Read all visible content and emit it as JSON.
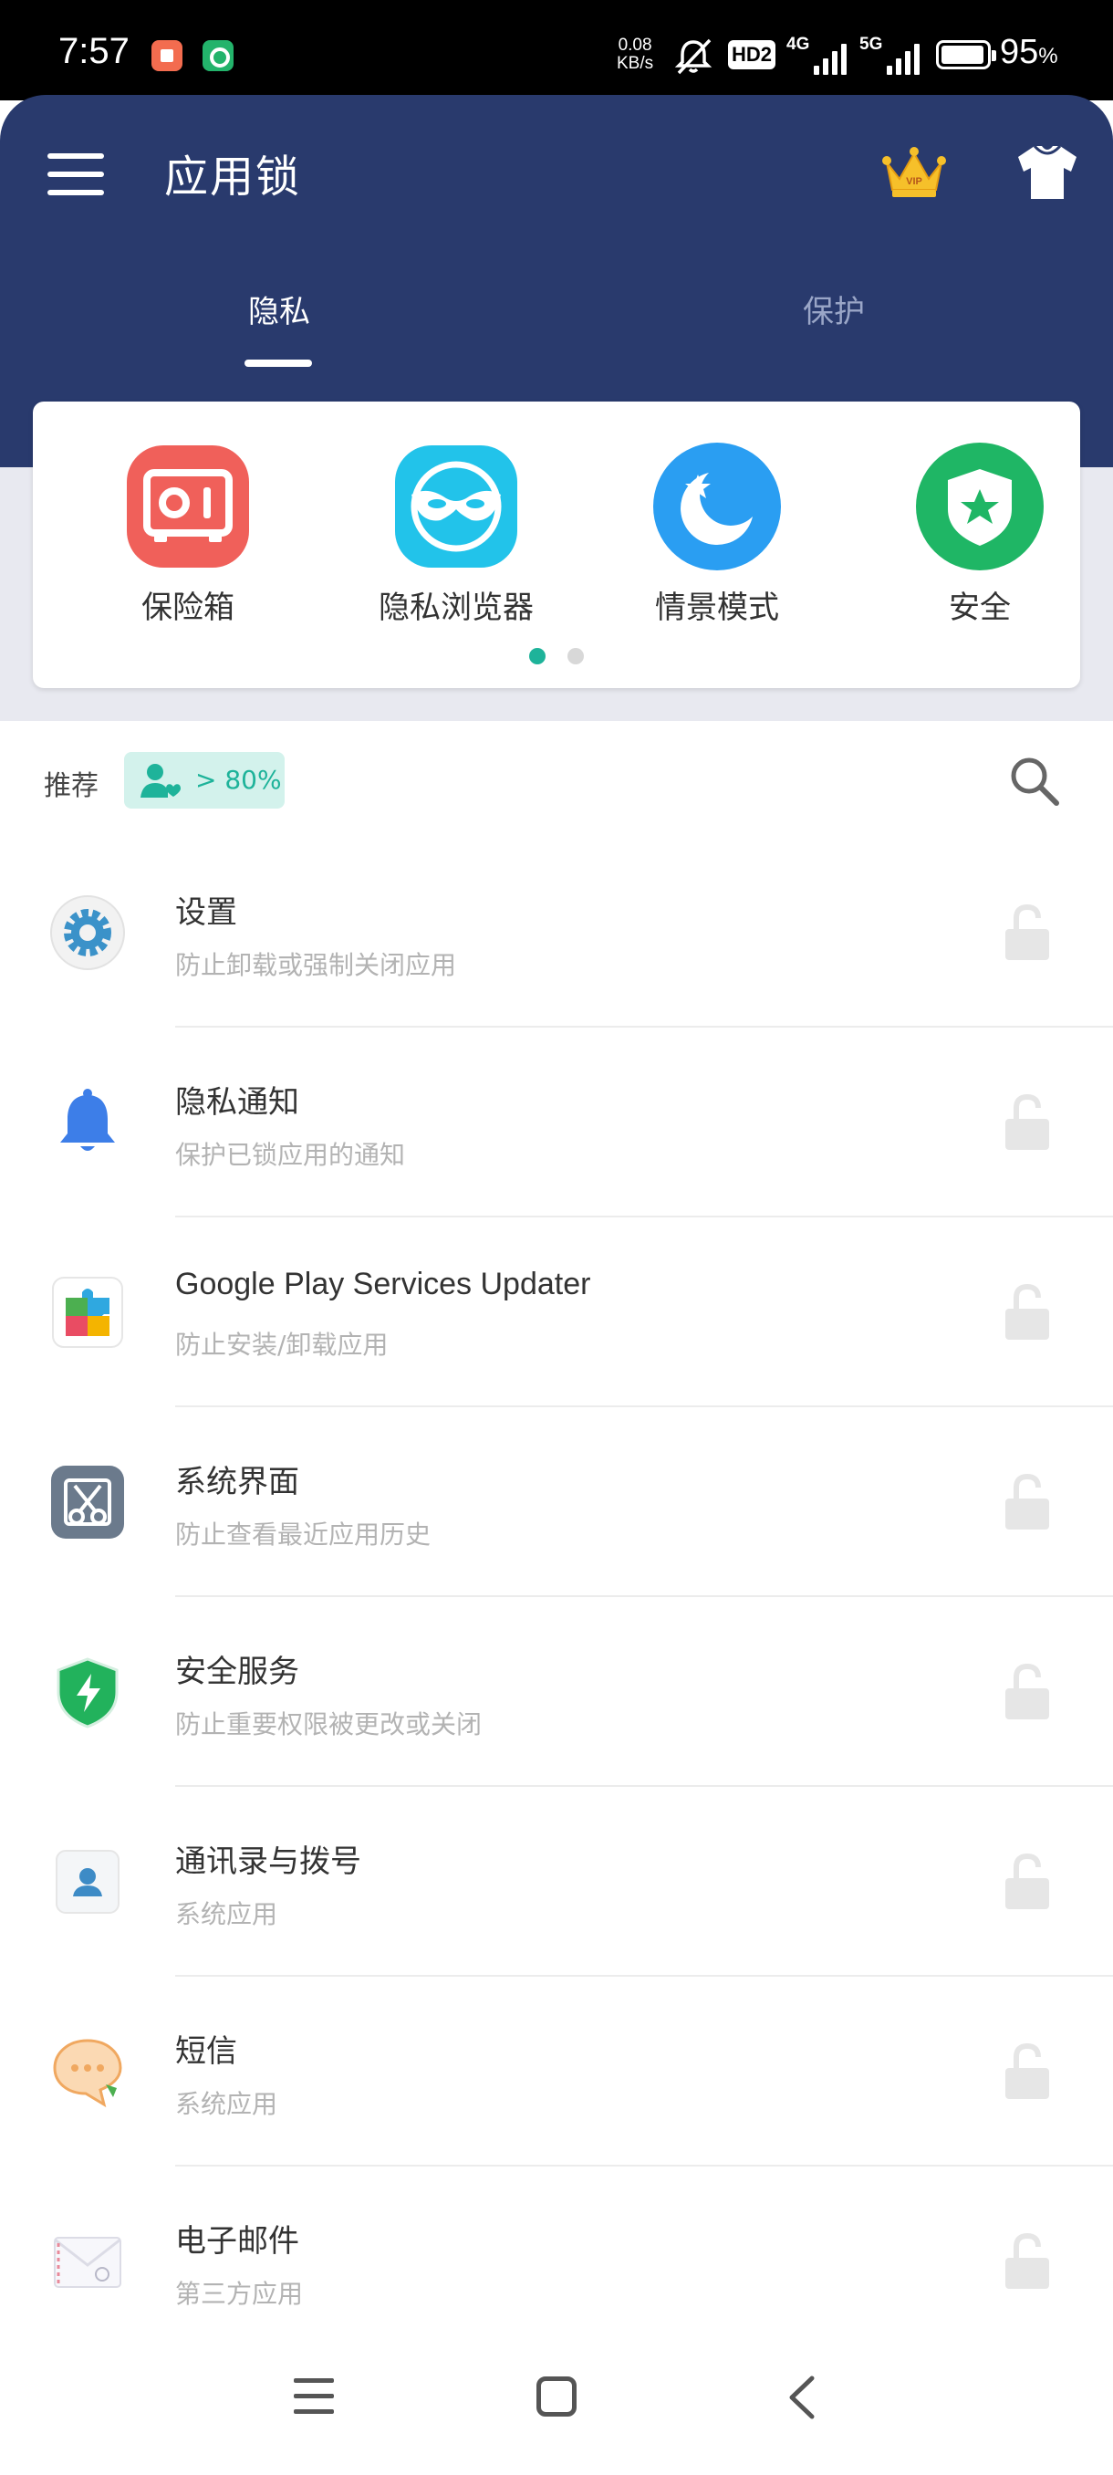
{
  "status_bar": {
    "time": "7:57",
    "speed_value": "0.08",
    "speed_unit": "KB/s",
    "hd_label": "HD2",
    "sig1_label": "4G",
    "sig2_label": "5G",
    "battery_pct": "95",
    "battery_unit": "%"
  },
  "header": {
    "title": "应用锁",
    "tabs": [
      {
        "label": "隐私",
        "active": true
      },
      {
        "label": "保护",
        "active": false
      }
    ],
    "vip_text": "VIP"
  },
  "features": [
    {
      "label": "保险箱",
      "icon": "safe-box-icon",
      "color": "#f0605a"
    },
    {
      "label": "隐私浏览器",
      "icon": "mask-icon",
      "color": "#22c3ea"
    },
    {
      "label": "情景模式",
      "icon": "moon-star-icon",
      "color": "#2a9ef2"
    },
    {
      "label": "安全",
      "icon": "shield-star-icon",
      "color": "#1fb665"
    }
  ],
  "recommend": {
    "label": "推荐",
    "badge": "> 80%"
  },
  "apps": [
    {
      "name": "设置",
      "desc": "防止卸载或强制关闭应用",
      "icon": "gear-icon"
    },
    {
      "name": "隐私通知",
      "desc": "保护已锁应用的通知",
      "icon": "bell-icon"
    },
    {
      "name": "Google Play Services Updater",
      "desc": "防止安装/卸载应用",
      "icon": "puzzle-icon"
    },
    {
      "name": "系统界面",
      "desc": "防止查看最近应用历史",
      "icon": "scissors-icon"
    },
    {
      "name": "安全服务",
      "desc": "防止重要权限被更改或关闭",
      "icon": "shield-bolt-icon"
    },
    {
      "name": "通讯录与拨号",
      "desc": "系统应用",
      "icon": "contact-icon"
    },
    {
      "name": "短信",
      "desc": "系统应用",
      "icon": "chat-bubble-icon"
    },
    {
      "name": "电子邮件",
      "desc": "第三方应用",
      "icon": "envelope-icon"
    }
  ],
  "colors": {
    "header": "#293a6d",
    "accent": "#1eb39a",
    "lock": "#e6e6e6"
  }
}
